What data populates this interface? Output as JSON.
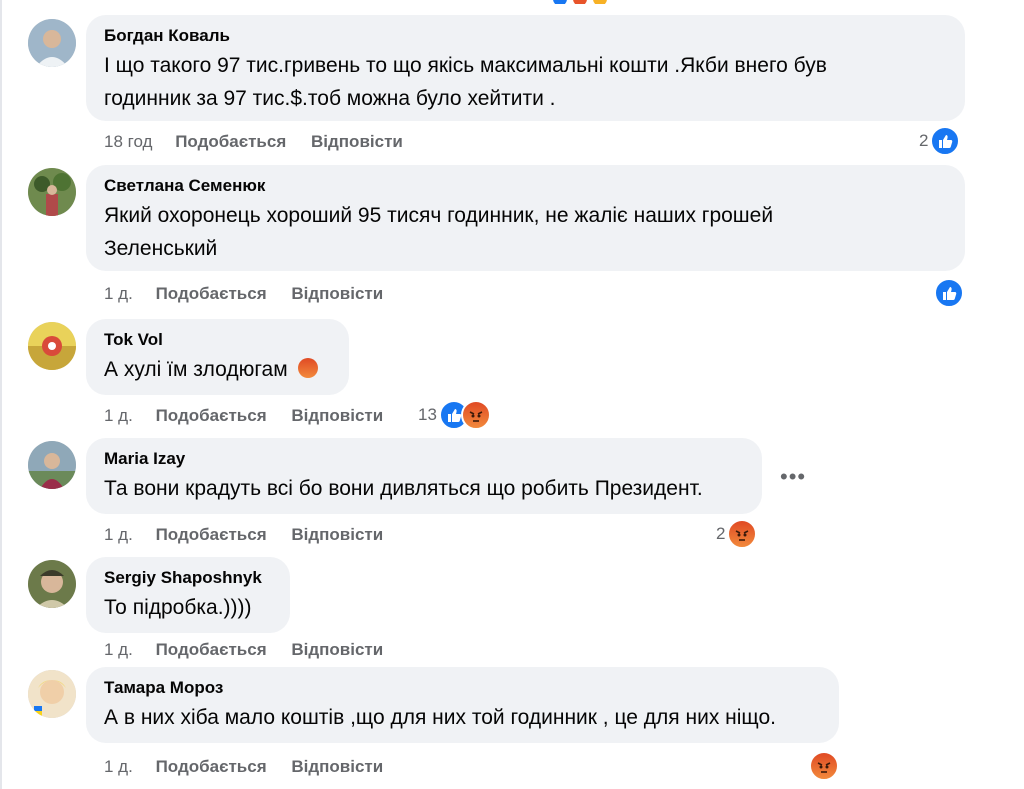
{
  "actions": {
    "like_label": "Подобається",
    "reply_label": "Відповісти"
  },
  "comments": [
    {
      "author": "Богдан Коваль",
      "text_line1": "І що такого 97 тис.гривень то що якісь максимальні кошти .Якби внего був",
      "text_line2": "годинник за 97 тис.$.тоб можна було хейтити .",
      "time": "18 год",
      "reaction_count": "2",
      "reactions": [
        "like"
      ]
    },
    {
      "author": "Светлана Семенюк",
      "text_line1": "Який охоронець хороший 95 тисяч годинник, не жаліє наших грошей",
      "text_line2": "Зеленський",
      "time": "1 д.",
      "reaction_count": "",
      "reactions": [
        "like"
      ]
    },
    {
      "author": "Tok Vol",
      "text_line1": "А хулі їм злодюгам",
      "time": "1 д.",
      "reaction_count": "13",
      "reactions": [
        "like",
        "angry"
      ]
    },
    {
      "author": "Maria Izay",
      "text_line1": "Та вони крадуть всі бо вони дивляться що робить Президент.",
      "time": "1 д.",
      "reaction_count": "2",
      "reactions": [
        "angry"
      ]
    },
    {
      "author": "Sergiy Shaposhnyk",
      "text_line1": "То підробка.))))",
      "time": "1 д.",
      "reaction_count": "",
      "reactions": []
    },
    {
      "author": "Тамара Мороз",
      "text_line1": "А в них хіба мало коштів ,що для них той годинник , це для них ніщо.",
      "time": "1 д.",
      "reaction_count": "",
      "reactions": [
        "angry"
      ]
    }
  ],
  "more_options_glyph": "•••",
  "colors": {
    "like": "#1877f2",
    "angry": "#e8542a",
    "bubble": "#f0f2f5",
    "meta": "#65676b"
  }
}
